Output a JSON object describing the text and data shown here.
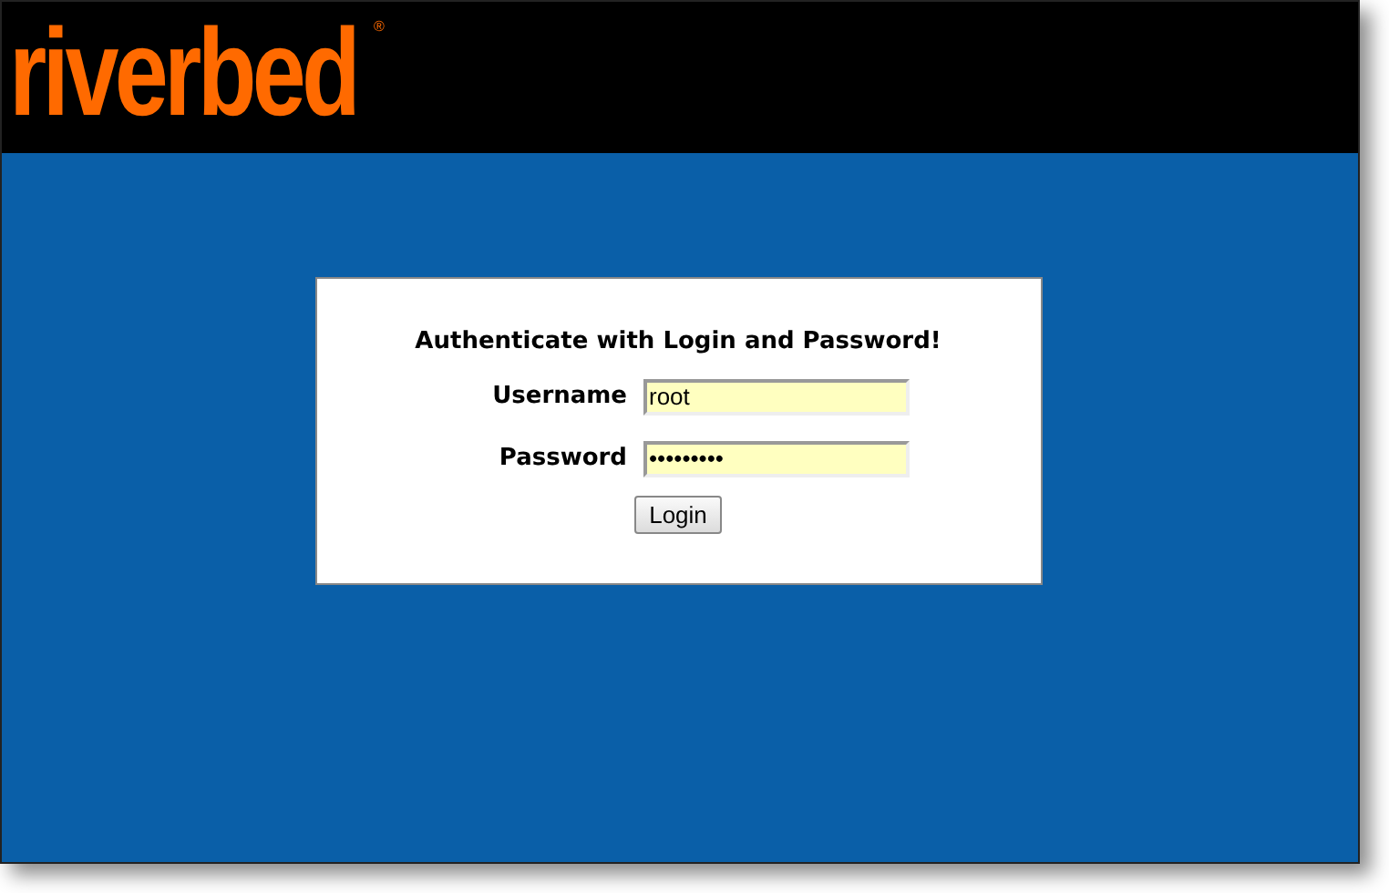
{
  "header": {
    "logo": "riverbed",
    "logo_mark": "®"
  },
  "login": {
    "heading": "Authenticate with Login and Password!",
    "fields": [
      {
        "label": "Username",
        "value": "root"
      },
      {
        "label": "Password",
        "value": "•••••••••"
      }
    ],
    "button": "Login"
  }
}
